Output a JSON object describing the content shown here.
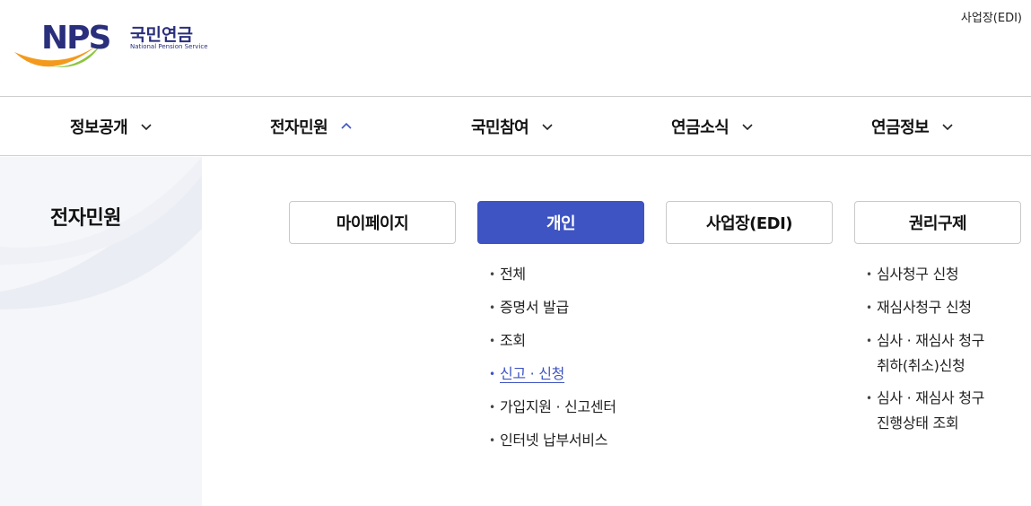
{
  "header": {
    "logo": {
      "mark": "NPS",
      "korean_name": "국민연금",
      "english_name": "National Pension Service"
    },
    "edi_link": "사업장(EDI)"
  },
  "gnb": {
    "items": [
      {
        "label": "정보공개",
        "state": "collapsed",
        "icon": "chevron-down-icon"
      },
      {
        "label": "전자민원",
        "state": "expanded",
        "icon": "chevron-up-icon"
      },
      {
        "label": "국민참여",
        "state": "collapsed",
        "icon": "chevron-down-icon"
      },
      {
        "label": "연금소식",
        "state": "collapsed",
        "icon": "chevron-down-icon"
      },
      {
        "label": "연금정보",
        "state": "collapsed",
        "icon": "chevron-down-icon"
      }
    ]
  },
  "panel": {
    "title": "전자민원"
  },
  "categories": [
    {
      "label": "마이페이지",
      "active": false
    },
    {
      "label": "개인",
      "active": true
    },
    {
      "label": "사업장(EDI)",
      "active": false
    },
    {
      "label": "권리구제",
      "active": false
    }
  ],
  "submenu_personal": [
    {
      "label": "전체"
    },
    {
      "label": "증명서 발급"
    },
    {
      "label": "조회"
    },
    {
      "label": "신고 · 신청",
      "current": true
    },
    {
      "label": "가입지원 · 신고센터"
    },
    {
      "label": "인터넷 납부서비스"
    }
  ],
  "submenu_rights": [
    {
      "line1": "심사청구 신청",
      "line2": ""
    },
    {
      "line1": "재심사청구 신청",
      "line2": ""
    },
    {
      "line1": "심사 · 재심사 청구",
      "line2": "취하(취소)신청"
    },
    {
      "line1": "심사 · 재심사 청구",
      "line2": "진행상태 조회"
    }
  ],
  "colors": {
    "accent": "#3e54c2",
    "logo_navy": "#2a2f7c",
    "logo_orange": "#f39a1e",
    "logo_green": "#8cc63f",
    "panel_bg": "#f5f6fa",
    "border": "#cfcfcf"
  }
}
